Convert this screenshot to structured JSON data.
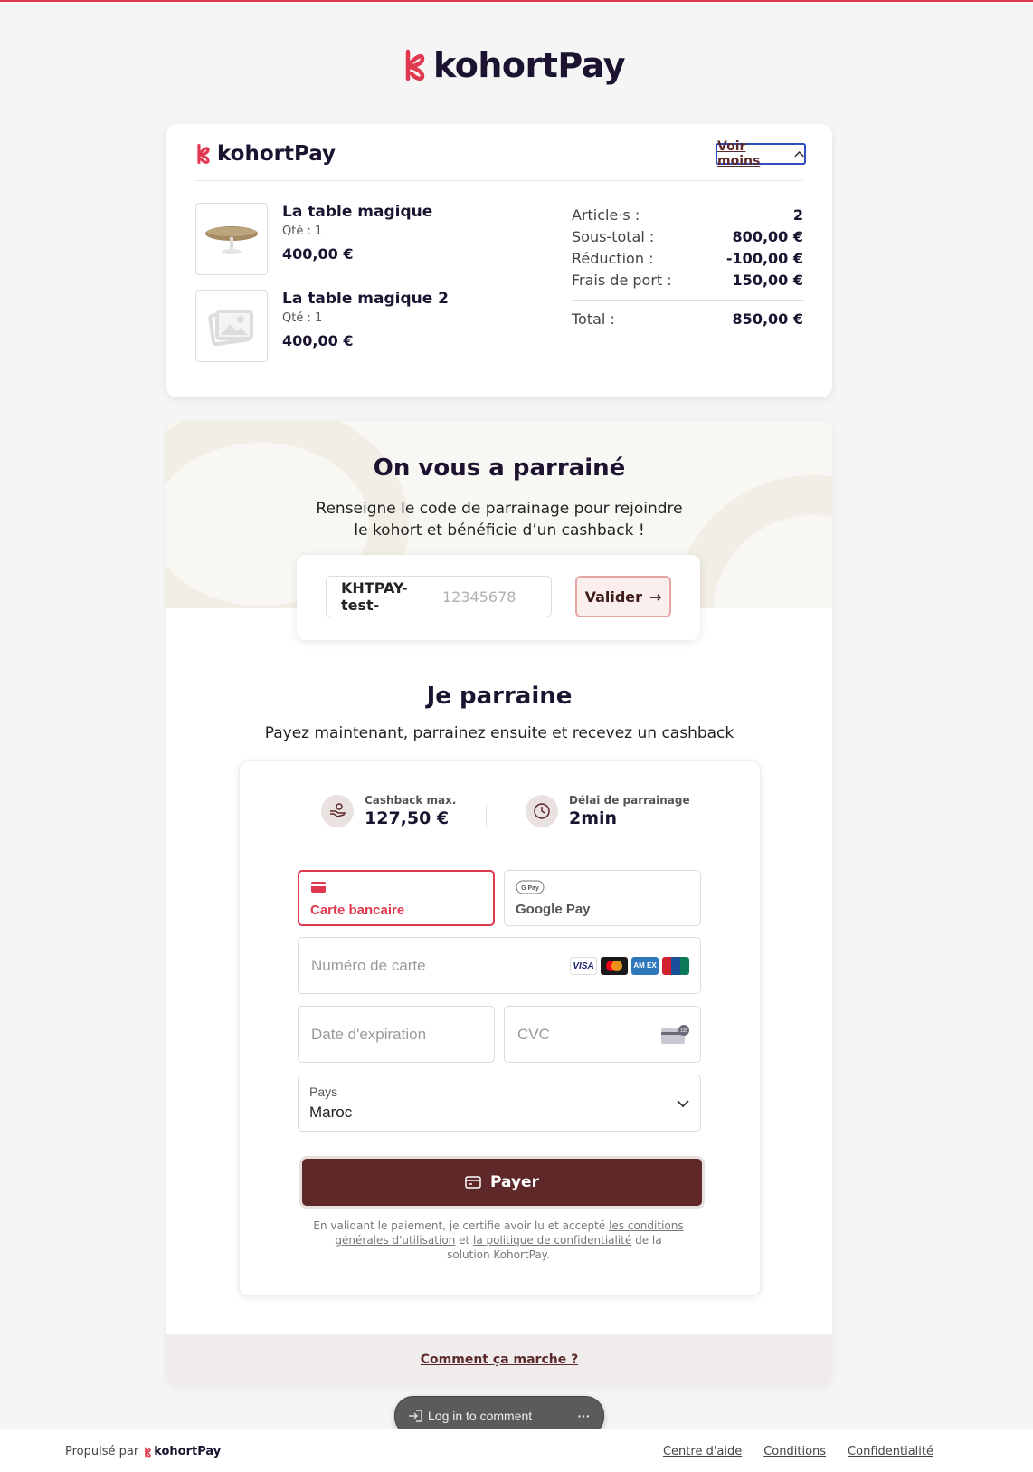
{
  "brand": {
    "name": "kohortPay",
    "name_prefix": "kohort",
    "name_suffix": "Pay",
    "accent": "#e0384f",
    "dark": "#5e2828"
  },
  "summary": {
    "toggle_label": "Voir moins",
    "items": [
      {
        "name": "La table magique",
        "qty": "Qté : 1",
        "price": "400,00 €"
      },
      {
        "name": "La table magique 2",
        "qty": "Qté : 1",
        "price": "400,00 €"
      }
    ],
    "totals": [
      {
        "label": "Article·s :",
        "value": "2"
      },
      {
        "label": "Sous-total :",
        "value": "800,00 €"
      },
      {
        "label": "Réduction :",
        "value": "-100,00 €"
      },
      {
        "label": "Frais de port :",
        "value": "150,00 €"
      }
    ],
    "total": {
      "label": "Total :",
      "value": "850,00 €"
    }
  },
  "referral": {
    "title": "On vous a parrainé",
    "subtitle_line1": "Renseigne le code de parrainage pour rejoindre",
    "subtitle_line2": "le kohort et bénéficie d’un cashback !",
    "code_prefix": "KHTPAY-test-",
    "code_placeholder": "12345678",
    "validate_label": "Valider",
    "validate_arrow": "→"
  },
  "sponsor": {
    "title": "Je parraine",
    "subtitle": "Payez maintenant, parrainez ensuite et recevez un cashback",
    "cashback_label": "Cashback max.",
    "cashback_value": "127,50 €",
    "delay_label": "Délai de parrainage",
    "delay_value": "2min"
  },
  "payment": {
    "methods": [
      {
        "label": "Carte bancaire",
        "icon": "credit-card-icon",
        "active": true
      },
      {
        "label": "Google Pay",
        "icon": "google-pay-icon",
        "active": false
      }
    ],
    "card_number_placeholder": "Numéro de carte",
    "expiry_placeholder": "Date d'expiration",
    "cvc_placeholder": "CVC",
    "country_label": "Pays",
    "country_value": "Maroc",
    "pay_label": "Payer",
    "legal": {
      "before": "En validant le paiement, je certifie avoir lu et accepté ",
      "terms": "les conditions générales d'utilisation",
      "middle": " et ",
      "privacy": "la politique de confidentialité",
      "after": " de la solution KohortPay."
    }
  },
  "how_it_works": "Comment ça marche ?",
  "comment_pill": {
    "login_label": "Log in to comment",
    "more": "···"
  },
  "footer": {
    "powered_by": "Propulsé par",
    "links": [
      "Centre d'aide",
      "Conditions",
      "Confidentialité"
    ]
  }
}
